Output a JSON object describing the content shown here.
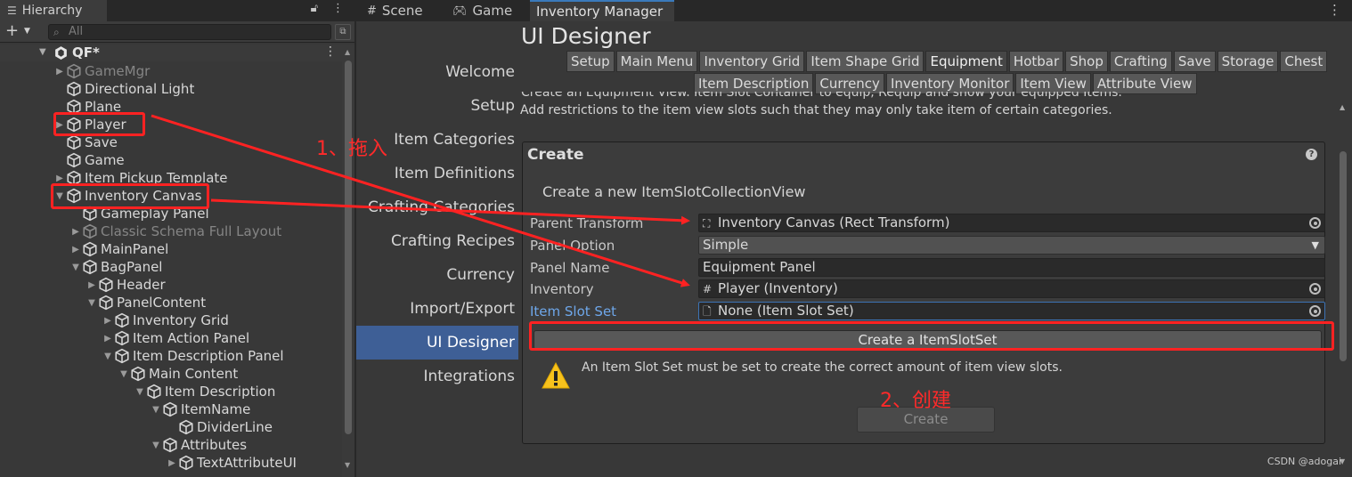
{
  "hierarchy": {
    "tab_title": "Hierarchy",
    "search_placeholder": "All",
    "scene_name": "QF*",
    "items": [
      {
        "label": "GameMgr",
        "depth": 0,
        "arrow": "right",
        "dim": true
      },
      {
        "label": "Directional Light",
        "depth": 0,
        "arrow": "",
        "dim": false
      },
      {
        "label": "Plane",
        "depth": 0,
        "arrow": "",
        "dim": false
      },
      {
        "label": "Player",
        "depth": 0,
        "arrow": "right",
        "dim": false
      },
      {
        "label": "Save",
        "depth": 0,
        "arrow": "",
        "dim": false
      },
      {
        "label": "Game",
        "depth": 0,
        "arrow": "",
        "dim": false
      },
      {
        "label": "Item Pickup Template",
        "depth": 0,
        "arrow": "right",
        "dim": false
      },
      {
        "label": "Inventory Canvas",
        "depth": 0,
        "arrow": "down",
        "dim": false
      },
      {
        "label": "Gameplay Panel",
        "depth": 1,
        "arrow": "",
        "dim": false
      },
      {
        "label": "Classic Schema Full Layout",
        "depth": 1,
        "arrow": "right",
        "dim": true
      },
      {
        "label": "MainPanel",
        "depth": 1,
        "arrow": "right",
        "dim": false
      },
      {
        "label": "BagPanel",
        "depth": 1,
        "arrow": "down",
        "dim": false
      },
      {
        "label": "Header",
        "depth": 2,
        "arrow": "right",
        "dim": false
      },
      {
        "label": "PanelContent",
        "depth": 2,
        "arrow": "down",
        "dim": false
      },
      {
        "label": "Inventory Grid",
        "depth": 3,
        "arrow": "right",
        "dim": false
      },
      {
        "label": "Item Action Panel",
        "depth": 3,
        "arrow": "right",
        "dim": false
      },
      {
        "label": "Item Description Panel",
        "depth": 3,
        "arrow": "down",
        "dim": false
      },
      {
        "label": "Main Content",
        "depth": 4,
        "arrow": "down",
        "dim": false
      },
      {
        "label": "Item Description",
        "depth": 5,
        "arrow": "down",
        "dim": false
      },
      {
        "label": "ItemName",
        "depth": 6,
        "arrow": "down",
        "dim": false
      },
      {
        "label": "DividerLine",
        "depth": 7,
        "arrow": "",
        "dim": false
      },
      {
        "label": "Attributes",
        "depth": 6,
        "arrow": "down",
        "dim": false
      },
      {
        "label": "TextAttributeUI",
        "depth": 7,
        "arrow": "right",
        "dim": false
      }
    ]
  },
  "window": {
    "tabs": [
      {
        "label": "Scene",
        "icon": "grid-icon"
      },
      {
        "label": "Game",
        "icon": "gamepad-icon"
      },
      {
        "label": "Inventory Manager",
        "icon": ""
      }
    ]
  },
  "nav": {
    "items": [
      "Welcome",
      "Setup",
      "Item Categories",
      "Item Definitions",
      "Crafting Categories",
      "Crafting Recipes",
      "Currency",
      "Import/Export",
      "UI Designer",
      "Integrations"
    ],
    "active": "UI Designer"
  },
  "designer": {
    "title": "UI Designer",
    "tabs_row1": [
      "Setup",
      "Main Menu",
      "Inventory Grid",
      "Item Shape Grid",
      "Equipment",
      "Hotbar",
      "Shop",
      "Crafting",
      "Save",
      "Storage",
      "Chest"
    ],
    "tabs_row2": [
      "Item Description",
      "Currency",
      "Inventory Monitor",
      "Item View",
      "Attribute View"
    ],
    "selected_tab": "Equipment",
    "description_clipped": "Create an Equipment View. Item Slot Container to equip, Requip and show your equipped Items.",
    "description": "Add restrictions to the item view slots such that they may only take item of certain categories.",
    "create": {
      "title": "Create",
      "subtitle": "Create a new ItemSlotCollectionView",
      "fields": [
        {
          "label": "Parent Transform",
          "value": "Inventory Canvas (Rect Transform)",
          "icon": "rect-transform-icon",
          "kind": "object"
        },
        {
          "label": "Panel Option",
          "value": "Simple",
          "icon": "",
          "kind": "dropdown"
        },
        {
          "label": "Panel Name",
          "value": "Equipment Panel",
          "icon": "",
          "kind": "text"
        },
        {
          "label": "Inventory",
          "value": "Player (Inventory)",
          "icon": "script-icon",
          "kind": "object"
        },
        {
          "label": "Item Slot Set",
          "value": "None (Item Slot Set)",
          "icon": "file-icon",
          "kind": "object"
        }
      ],
      "create_set_button": "Create a ItemSlotSet",
      "warning": "An Item Slot Set must be set to create the correct amount of item view slots.",
      "create_button": "Create"
    }
  },
  "annotations": {
    "step1": "1、拖入",
    "step2": "2、创建",
    "color": "#ff2222"
  },
  "watermark": "CSDN @adogai"
}
